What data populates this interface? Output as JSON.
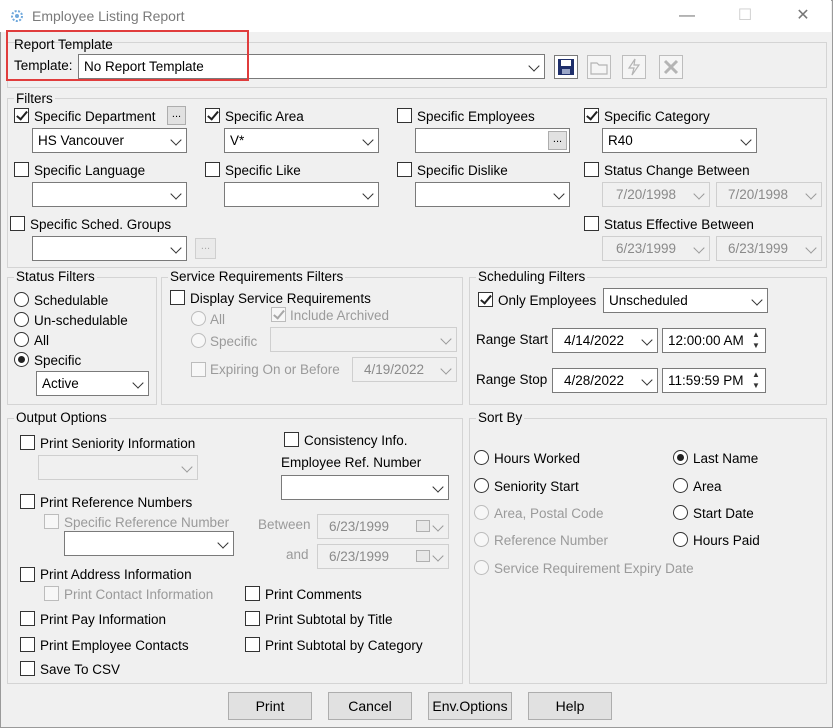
{
  "window": {
    "title": "Employee Listing Report",
    "controls": [
      "minimize-icon",
      "maximize-icon",
      "close-icon"
    ]
  },
  "report_template": {
    "group_label": "Report Template",
    "template_label": "Template:",
    "template_value": "No Report Template"
  },
  "filters": {
    "group_label": "Filters",
    "specific_department": {
      "label": "Specific Department",
      "checked": true,
      "value": "HS Vancouver"
    },
    "specific_area": {
      "label": "Specific Area",
      "checked": true,
      "value": "V*"
    },
    "specific_employees": {
      "label": "Specific Employees",
      "checked": false,
      "value": ""
    },
    "specific_category": {
      "label": "Specific Category",
      "checked": true,
      "value": "R40"
    },
    "specific_language": {
      "label": "Specific Language",
      "checked": false,
      "value": ""
    },
    "specific_like": {
      "label": "Specific Like",
      "checked": false,
      "value": ""
    },
    "specific_dislike": {
      "label": "Specific Dislike",
      "checked": false,
      "value": ""
    },
    "status_change_between": {
      "label": "Status Change Between",
      "checked": false,
      "from": "7/20/1998",
      "to": "7/20/1998"
    },
    "specific_sched_groups": {
      "label": "Specific Sched. Groups",
      "checked": false,
      "value": ""
    },
    "status_effective_between": {
      "label": "Status Effective Between",
      "checked": false,
      "from": "6/23/1999",
      "to": "6/23/1999"
    },
    "ellipsis": "..."
  },
  "status_filters": {
    "group_label": "Status Filters",
    "options": [
      "Schedulable",
      "Un-schedulable",
      "All",
      "Specific"
    ],
    "selected": "Specific",
    "specific_value": "Active"
  },
  "service_requirements": {
    "group_label": "Service Requirements Filters",
    "display_label": "Display Service Requirements",
    "all_label": "All",
    "include_archived_label": "Include Archived",
    "specific_label": "Specific",
    "expiring_label": "Expiring On or Before",
    "expiring_value": "4/19/2022"
  },
  "scheduling_filters": {
    "group_label": "Scheduling Filters",
    "only_employees_label": "Only Employees",
    "only_employees_value": "Unscheduled",
    "range_start_label": "Range Start",
    "range_start_date": "4/14/2022",
    "range_start_time": "12:00:00 AM",
    "range_stop_label": "Range Stop",
    "range_stop_date": "4/28/2022",
    "range_stop_time": "11:59:59 PM"
  },
  "output_options": {
    "group_label": "Output Options",
    "print_seniority": "Print Seniority Information",
    "consistency_info": "Consistency Info.",
    "employee_ref_number": "Employee Ref. Number",
    "print_reference_numbers": "Print Reference Numbers",
    "specific_reference_number": "Specific Reference Number",
    "between_label": "Between",
    "between_value": "6/23/1999",
    "and_label": "and",
    "and_value": "6/23/1999",
    "print_address": "Print Address Information",
    "print_contact": "Print Contact Information",
    "print_comments": "Print Comments",
    "print_pay": "Print Pay Information",
    "print_subtotal_title": "Print Subtotal by Title",
    "print_employee_contacts": "Print Employee Contacts",
    "print_subtotal_category": "Print Subtotal by Category",
    "save_to_csv": "Save To CSV"
  },
  "sort_by": {
    "group_label": "Sort By",
    "hours_worked": "Hours Worked",
    "last_name": "Last Name",
    "seniority_start": "Seniority Start",
    "area": "Area",
    "area_postal": "Area, Postal Code",
    "start_date": "Start Date",
    "reference_number": "Reference Number",
    "hours_paid": "Hours Paid",
    "service_expiry": "Service Requirement Expiry Date",
    "selected": "Last Name"
  },
  "buttons": {
    "print": "Print",
    "cancel": "Cancel",
    "env_options": "Env.Options",
    "help": "Help"
  },
  "colors": {
    "highlight": "#e03c3c",
    "window_bg": "#f0f0f0"
  }
}
